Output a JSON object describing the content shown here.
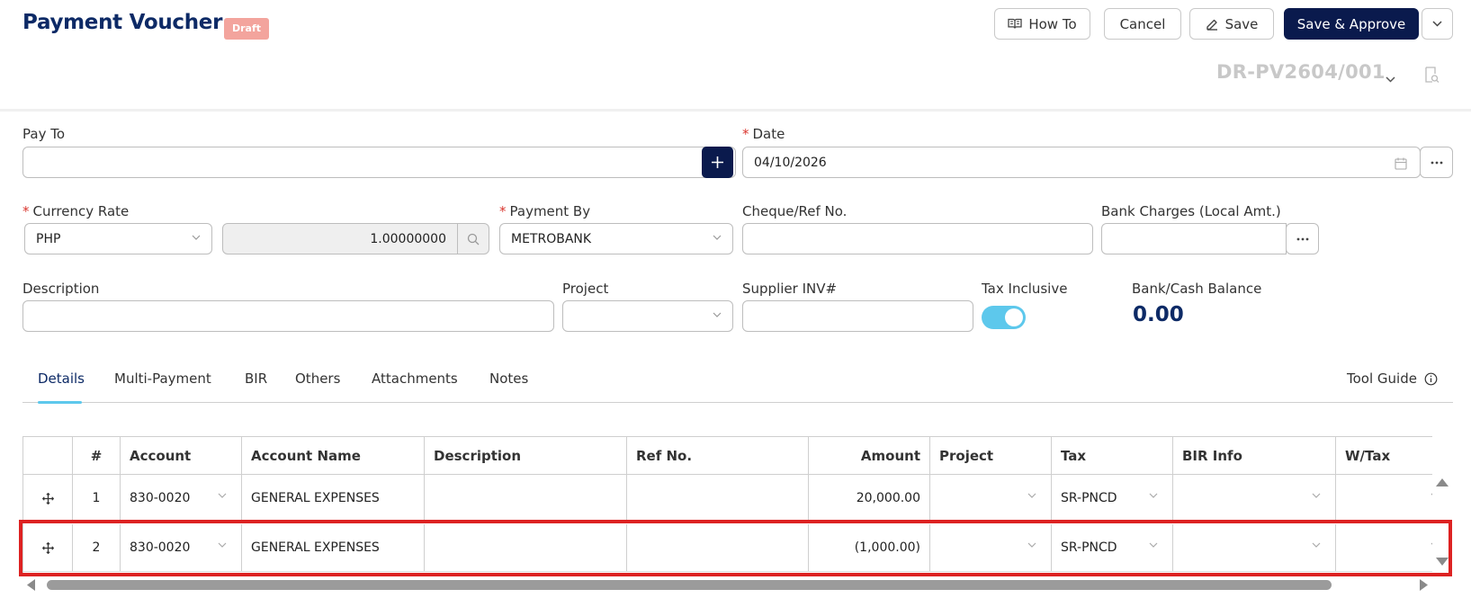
{
  "header": {
    "title": "Payment Voucher",
    "status_badge": "Draft",
    "how_to_label": "How To",
    "cancel_label": "Cancel",
    "save_label": "Save",
    "save_approve_label": "Save & Approve",
    "document_number": "DR-PV2604/001"
  },
  "form": {
    "pay_to": {
      "label": "Pay To",
      "value": ""
    },
    "date": {
      "label": "Date",
      "value": "04/10/2026",
      "required": true
    },
    "currency_rate": {
      "label": "Currency Rate",
      "currency": "PHP",
      "rate": "1.00000000",
      "required": true
    },
    "payment_by": {
      "label": "Payment By",
      "value": "METROBANK",
      "required": true
    },
    "cheque_ref": {
      "label": "Cheque/Ref No.",
      "value": ""
    },
    "bank_charges": {
      "label": "Bank Charges (Local Amt.)",
      "value": ""
    },
    "description": {
      "label": "Description",
      "value": ""
    },
    "project": {
      "label": "Project",
      "value": ""
    },
    "supplier_inv": {
      "label": "Supplier INV#",
      "value": ""
    },
    "tax_inclusive": {
      "label": "Tax Inclusive",
      "on": true
    },
    "balance": {
      "label": "Bank/Cash Balance",
      "value": "0.00"
    }
  },
  "tabs": [
    "Details",
    "Multi-Payment",
    "BIR",
    "Others",
    "Attachments",
    "Notes"
  ],
  "active_tab": "Details",
  "tool_guide_label": "Tool Guide",
  "grid": {
    "columns": [
      "",
      "#",
      "Account",
      "Account Name",
      "Description",
      "Ref No.",
      "Amount",
      "Project",
      "Tax",
      "BIR Info",
      "W/Tax"
    ],
    "rows": [
      {
        "no": "1",
        "account": "830-0020",
        "account_name": "GENERAL EXPENSES",
        "description": "",
        "ref_no": "",
        "amount": "20,000.00",
        "project": "",
        "tax": "SR-PNCD",
        "bir_info": "",
        "wtax": ""
      },
      {
        "no": "2",
        "account": "830-0020",
        "account_name": "GENERAL EXPENSES",
        "description": "",
        "ref_no": "",
        "amount": "(1,000.00)",
        "project": "",
        "tax": "SR-PNCD",
        "bir_info": "",
        "wtax": ""
      }
    ]
  },
  "colors": {
    "brand": "#0d2a66",
    "primary_button": "#0a1a4d",
    "accent": "#5dc8ec",
    "badge": "#f3a49d",
    "highlight": "#dd2222"
  }
}
